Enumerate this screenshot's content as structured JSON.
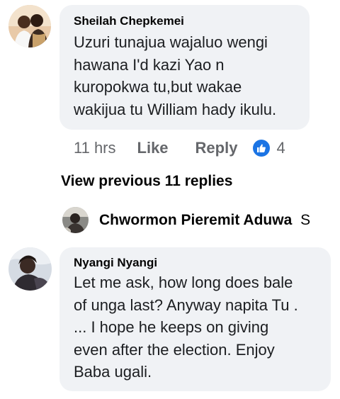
{
  "comments": [
    {
      "author": "Sheilah Chepkemei",
      "lines": [
        "Uzuri tunajua wajaluo wengi",
        "hawana I'd kazi Yao n",
        "kuropokwa tu,but wakae",
        "wakijua tu William hady ikulu."
      ],
      "time": "11 hrs",
      "like_label": "Like",
      "reply_label": "Reply",
      "reaction_count": "4",
      "reaction_icon": "like-thumb-icon"
    },
    {
      "author": "Nyangi Nyangi",
      "lines": [
        "Let me ask, how long does bale",
        "of unga last? Anyway napita Tu .",
        "... I hope he keeps on giving",
        "even after the election. Enjoy",
        "Baba ugali."
      ]
    }
  ],
  "view_previous_label": "View previous 11 replies",
  "reply_preview": {
    "author": "Chwormon Pieremit Aduwa",
    "cut_text": "S"
  },
  "colors": {
    "bubble": "#f0f2f5",
    "meta_text": "#65676b",
    "like_blue": "#1b74e4"
  }
}
